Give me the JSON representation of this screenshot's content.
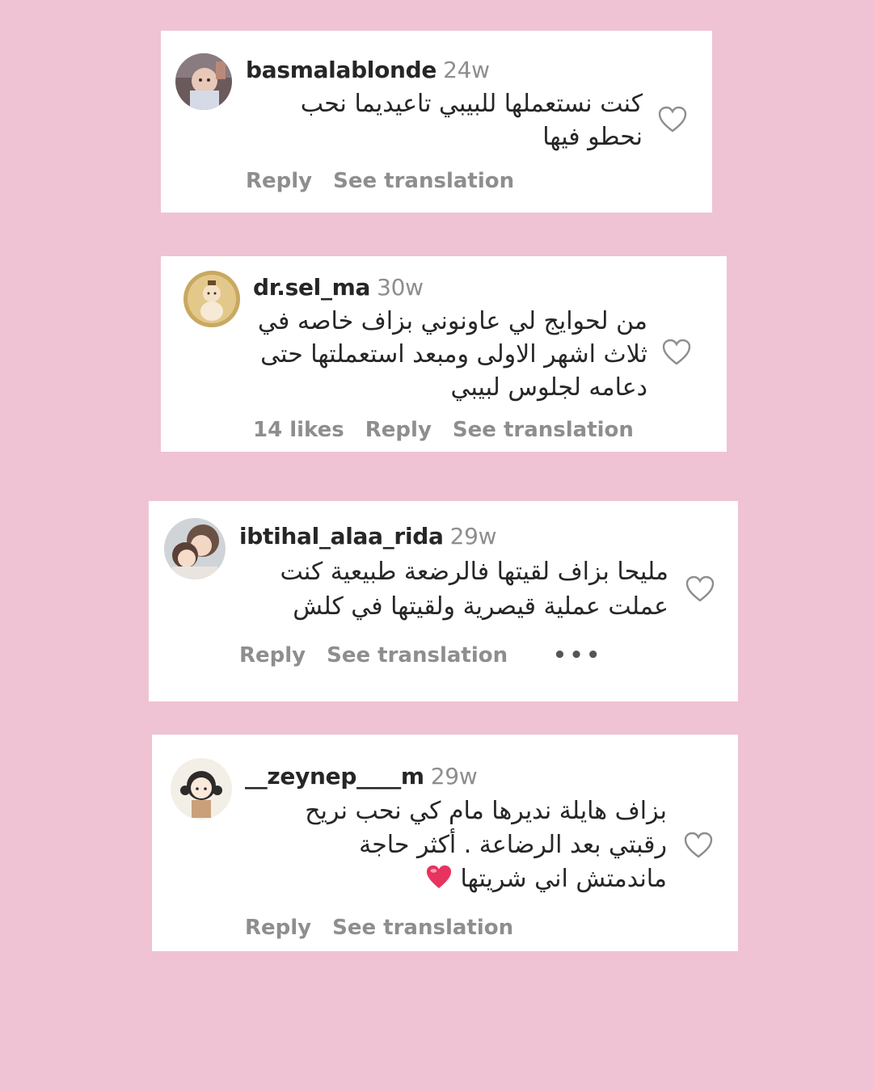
{
  "colors": {
    "page_background": "#efc3d3",
    "card_background": "#ffffff",
    "username": "#262626",
    "muted": "#8e8e8e",
    "emoji_heart": "#e8335f"
  },
  "comments": [
    {
      "username": "basmalablonde",
      "time": "24w",
      "lines": [
        "كنت نستعملها للبيبي تاعيديما نحب",
        "نحطو فيها"
      ],
      "actions": {
        "reply": "Reply",
        "see_translation": "See translation"
      },
      "avatar_icon": "baby-photo-avatar"
    },
    {
      "username": "dr.sel_ma",
      "time": "30w",
      "lines": [
        "من لحوايج لي عاونوني بزاف خاصه في",
        "ثلاث اشهر الاولى ومبعد استعملتها حتى",
        "دعامه لجلوس لبيبي"
      ],
      "actions": {
        "likes": "14 likes",
        "reply": "Reply",
        "see_translation": "See translation"
      },
      "avatar_icon": "baby-drawing-avatar"
    },
    {
      "username": "ibtihal_alaa_rida",
      "time": "29w",
      "lines": [
        "مليحا بزاف لقيتها فالرضعة طبيعية كنت",
        "عملت عملية قيصرية ولقيتها في كلش"
      ],
      "actions": {
        "reply": "Reply",
        "see_translation": "See translation",
        "more": "•••"
      },
      "avatar_icon": "mother-baby-avatar"
    },
    {
      "username": "__zeynep____m",
      "time": "29w",
      "lines": [
        "بزاف هايلة نديرها مام كي نحب نريح",
        "رقبتي بعد الرضاعة . أكثر حاجة",
        "ماندمتش اني شريتها"
      ],
      "actions": {
        "reply": "Reply",
        "see_translation": "See translation"
      },
      "avatar_icon": "cartoon-girl-avatar"
    }
  ]
}
